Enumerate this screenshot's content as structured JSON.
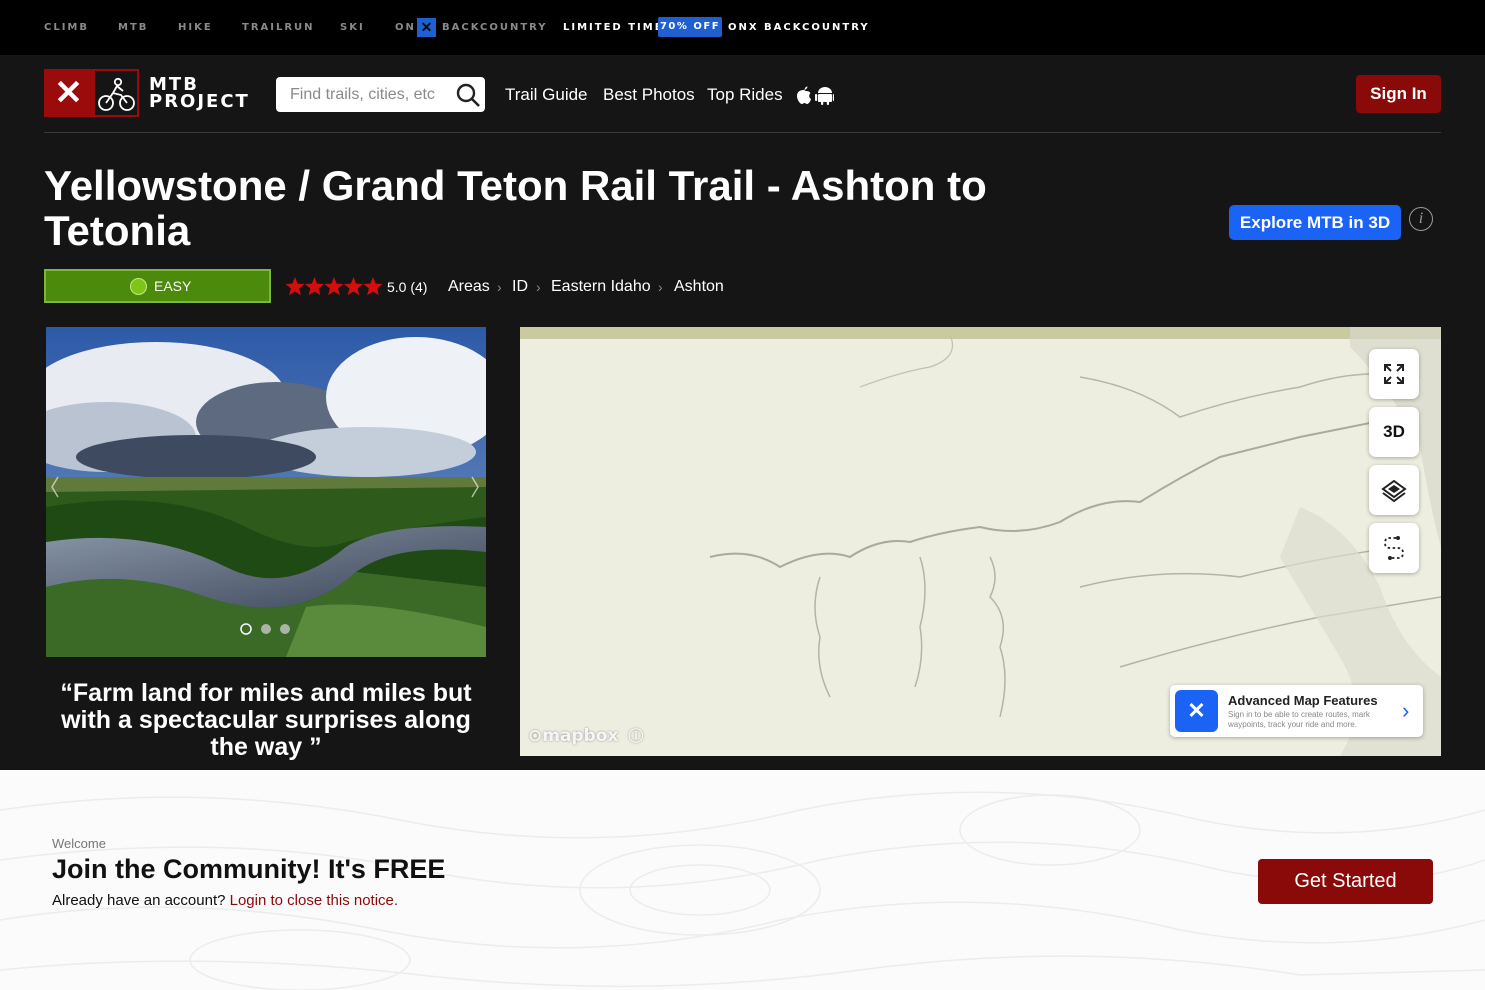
{
  "topbar": {
    "sports": [
      "CLIMB",
      "MTB",
      "HIKE",
      "TRAILRUN",
      "SKI"
    ],
    "on_label": "ON",
    "onx_mark": "✕",
    "backcountry_label": "BACKCOUNTRY",
    "limited_time": "LIMITED TIME",
    "off_badge": "70% OFF",
    "onx_backcountry": "ONX BACKCOUNTRY",
    "accent_color": "#1f5fd1"
  },
  "header": {
    "logo_mark": "✕",
    "logo_line1": "MTB",
    "logo_line2": "PROJECT",
    "search_placeholder": "Find trails, cities, etc",
    "nav": [
      "Trail Guide",
      "Best Photos",
      "Top Rides"
    ],
    "sign_in": "Sign In",
    "brand_color": "#8a0a0a"
  },
  "trail": {
    "title": "Yellowstone / Grand Teton Rail Trail - Ashton to Tetonia",
    "explore_label": "Explore MTB in 3D",
    "info_glyph": "i",
    "difficulty": "EASY",
    "difficulty_color": "#4b8a0b",
    "rating": 5.0,
    "rating_text": "5.0 (4)",
    "stars_filled": 5,
    "breadcrumbs": [
      "Areas",
      "ID",
      "Eastern Idaho",
      "Ashton"
    ],
    "quote": "“Farm land for miles and miles but with a spectacular surprises along the way ”",
    "photo_count": 3,
    "photo_active_index": 0
  },
  "map": {
    "buttons": [
      "expand-icon",
      "3D",
      "layers-icon",
      "route-icon"
    ],
    "attribution": "mapbox",
    "advanced_title": "Advanced Map Features",
    "advanced_desc": "Sign in to be able to create routes, mark waypoints, track your ride and more.",
    "advanced_mark": "✕",
    "advanced_chevron": "›"
  },
  "notice": {
    "welcome": "Welcome",
    "headline": "Join the Community! It's FREE",
    "already": "Already have an account?",
    "login_link": "Login to close this notice.",
    "cta": "Get Started"
  }
}
